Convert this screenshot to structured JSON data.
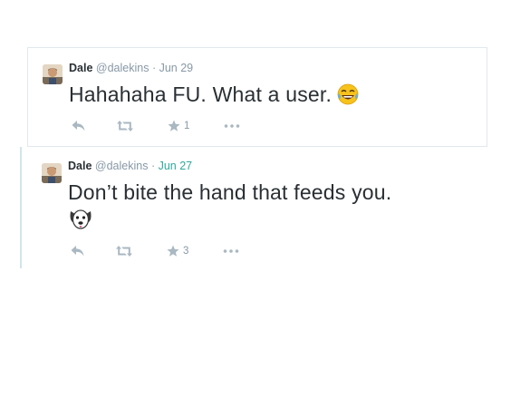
{
  "tweets": [
    {
      "name": "Dale",
      "handle": "@dalekins",
      "separator": "·",
      "date": "Jun 29",
      "text": "Hahahaha FU. What a user.",
      "emoji": "face-with-tears-of-joy-icon",
      "favorite_count": "1"
    },
    {
      "name": "Dale",
      "handle": "@dalekins",
      "separator": "·",
      "date": "Jun 27",
      "text": "Don’t bite the hand that feeds you.",
      "emoji": "dog-face-icon",
      "favorite_count": "3"
    }
  ],
  "colors": {
    "name": "#292f33",
    "meta": "#8899a6",
    "date_highlight": "#2fa89d",
    "action_icon": "#aab8c2",
    "border": "#e1e8ed",
    "thread_line": "#cfe6ea"
  }
}
